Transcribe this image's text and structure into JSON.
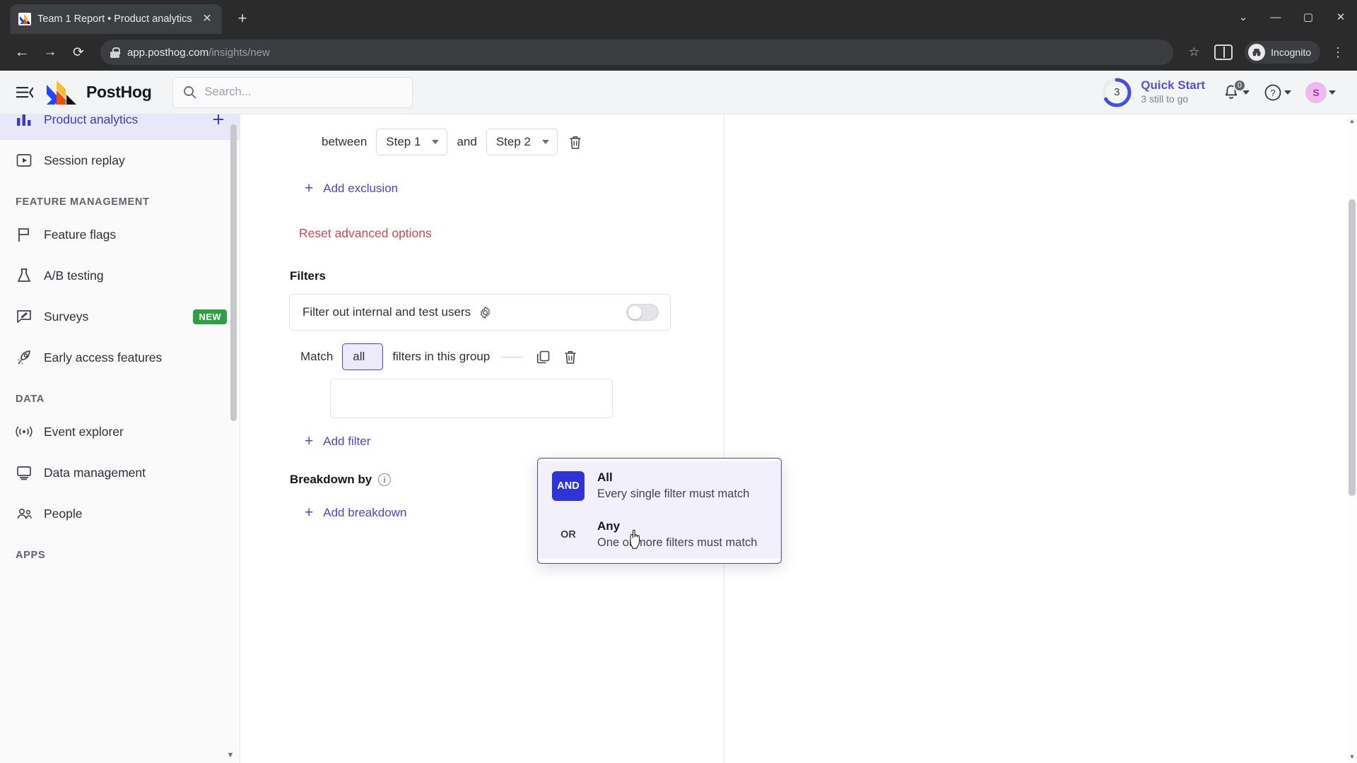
{
  "browser": {
    "tab": {
      "title": "Team 1 Report • Product analytics",
      "close_label": "✕",
      "favicon": "posthog-favicon"
    },
    "new_tab_label": "+",
    "window": {
      "minimize": "—",
      "maximize": "▢",
      "close": "✕",
      "collapse": "⌄"
    },
    "nav": {
      "back": "←",
      "forward": "→",
      "reload": "⟳"
    },
    "url": {
      "host": "app.posthog.com",
      "path": "/insights/new",
      "lock": "secure-lock"
    },
    "star_label": "☆",
    "profile": {
      "label": "Incognito",
      "glyph": "incognito-hat"
    },
    "menu_label": "⋮"
  },
  "topbar": {
    "hamburger": "collapse-sidebar",
    "brand": "PostHog",
    "search": {
      "placeholder": "Search...",
      "value": ""
    },
    "quick_start": {
      "title": "Quick Start",
      "subtitle": "3 still to go",
      "count": "3",
      "progress_percent": 66
    },
    "notifications": {
      "count": "0"
    },
    "help": "?",
    "avatar_initial": "S"
  },
  "sidebar": {
    "items": [
      {
        "label": "Product analytics",
        "icon": "bar-chart-icon",
        "active": true,
        "trailing": "add-icon"
      },
      {
        "label": "Session replay",
        "icon": "play-square-icon",
        "active": false
      }
    ],
    "sections": [
      {
        "title": "FEATURE MANAGEMENT",
        "items": [
          {
            "label": "Feature flags",
            "icon": "flag-icon"
          },
          {
            "label": "A/B testing",
            "icon": "flask-icon"
          },
          {
            "label": "Surveys",
            "icon": "survey-icon",
            "badge": "NEW"
          },
          {
            "label": "Early access features",
            "icon": "rocket-icon"
          }
        ]
      },
      {
        "title": "DATA",
        "items": [
          {
            "label": "Event explorer",
            "icon": "broadcast-icon"
          },
          {
            "label": "Data management",
            "icon": "monitor-icon"
          },
          {
            "label": "People",
            "icon": "people-icon"
          }
        ]
      },
      {
        "title": "APPS",
        "items": []
      }
    ]
  },
  "insight": {
    "exclusion_row": {
      "between_label": "between",
      "from_step": "Step 1",
      "and_label": "and",
      "to_step": "Step 2",
      "delete_icon": "trash-icon"
    },
    "add_exclusion": "Add exclusion",
    "reset_advanced": "Reset advanced options",
    "filters_heading": "Filters",
    "internal_users": {
      "label": "Filter out internal and test users",
      "settings_icon": "gear-icon",
      "enabled": false
    },
    "match_row": {
      "prefix": "Match",
      "value": "all",
      "suffix": "filters in this group",
      "duplicate_icon": "copy-icon",
      "delete_icon": "trash-icon"
    },
    "add_filter": "Add filter",
    "breakdown_heading": "Breakdown by",
    "breakdown_info": "i",
    "add_breakdown": "Add breakdown"
  },
  "dropdown": {
    "options": [
      {
        "tag": "AND",
        "title": "All",
        "description": "Every single filter must match",
        "selected": true
      },
      {
        "tag": "OR",
        "title": "Any",
        "description": "One or more filters must match",
        "selected": false
      }
    ]
  },
  "colors": {
    "brand_purple": "#4a45d2",
    "and_blue": "#2f34d6",
    "danger_red": "#d14852",
    "new_green": "#2ea043",
    "avatar_pink": "#edb9ef"
  }
}
